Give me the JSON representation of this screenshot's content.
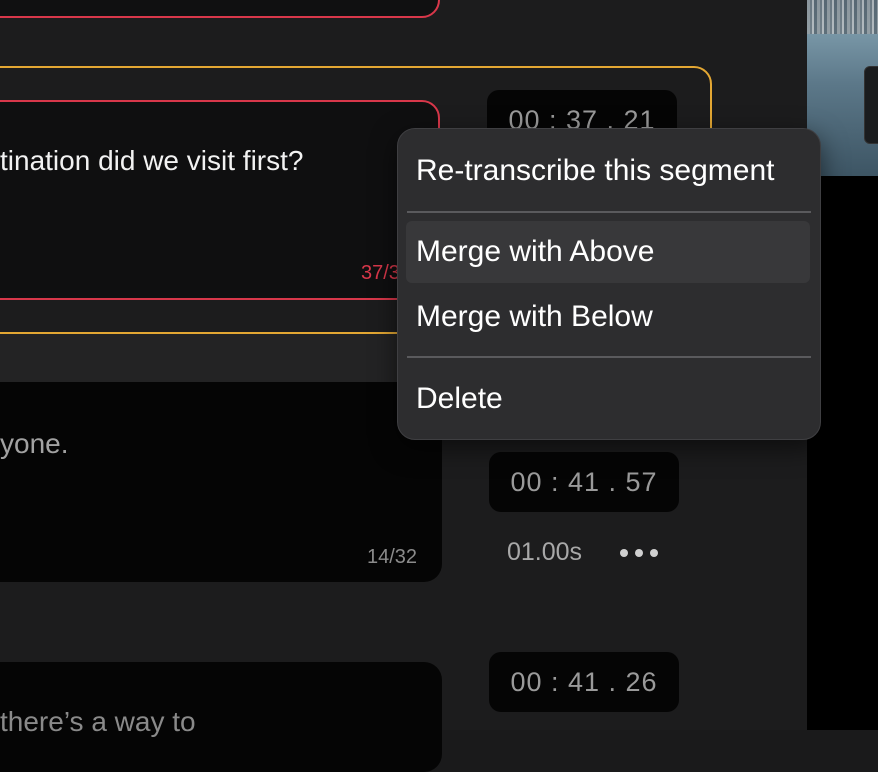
{
  "segments": [
    {
      "text": "tination did we visit first?",
      "count": "37/3"
    },
    {
      "text": "yone.",
      "count": "14/32"
    },
    {
      "text": "there’s a way to"
    }
  ],
  "timestamps": [
    "00 : 37 . 21",
    "00 : 41 . 57",
    "00 : 41 . 26"
  ],
  "duration": "01.00s",
  "context_menu": {
    "items": [
      "Re-transcribe this segment",
      "Merge with Above",
      "Merge with Below",
      "Delete"
    ]
  },
  "colors": {
    "active_border": "#e3a733",
    "error_border": "#d8374a",
    "menu_bg": "#2d2d2f",
    "menu_hover": "#38383a",
    "panel_bg": "#1c1c1d"
  },
  "icons": [
    "more-options-icon"
  ]
}
